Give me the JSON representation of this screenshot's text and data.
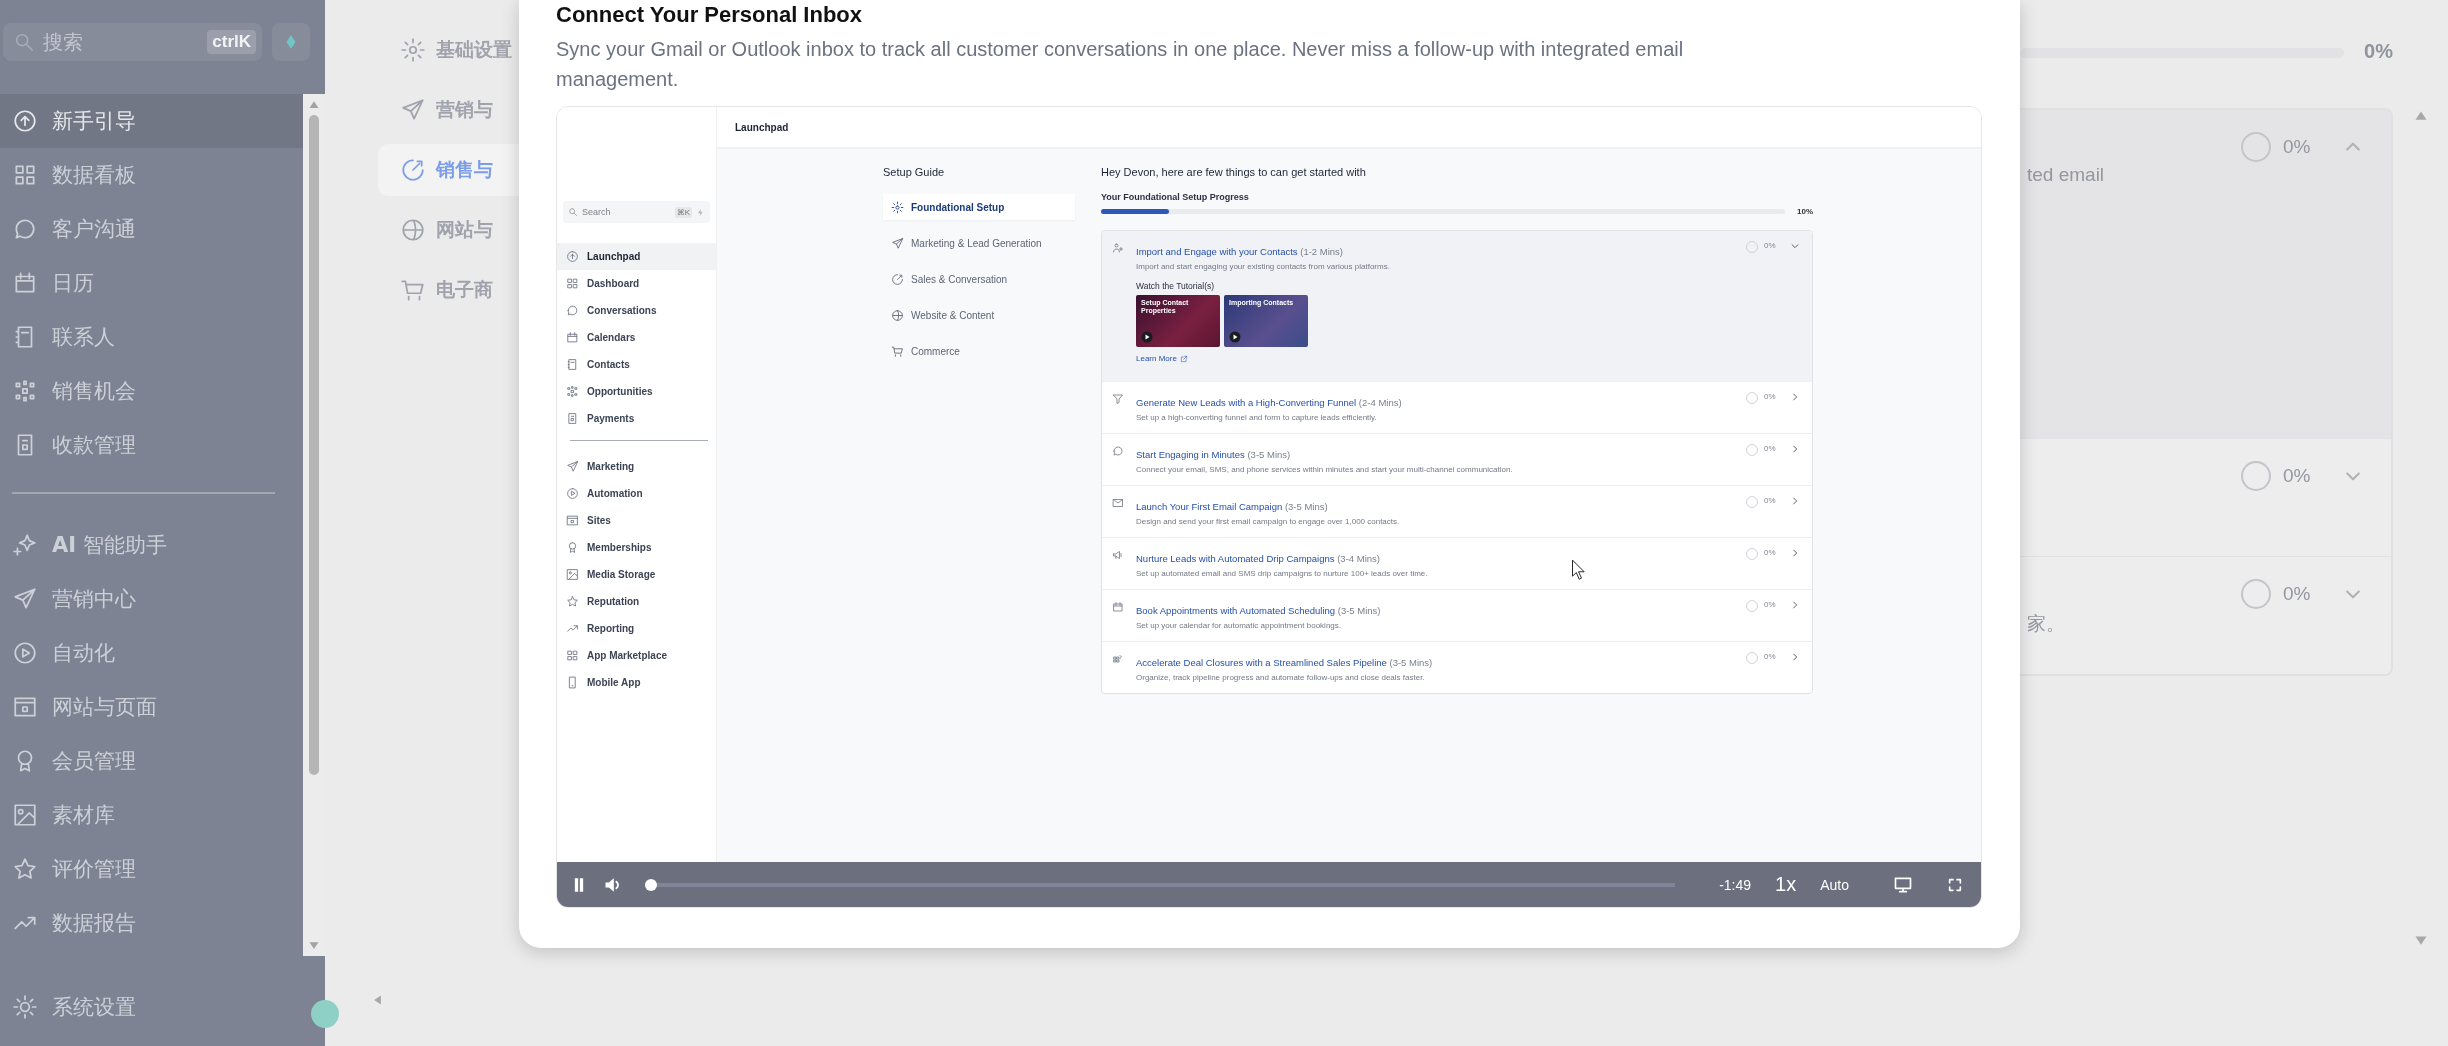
{
  "sidebar": {
    "search": {
      "placeholder": "搜索",
      "shortcut": "ctrlK"
    },
    "sections": [
      [
        {
          "label": "新手引导",
          "selected": true
        },
        {
          "label": "数据看板",
          "selected": false
        },
        {
          "label": "客户沟通",
          "selected": false
        },
        {
          "label": "日历",
          "selected": false
        },
        {
          "label": "联系人",
          "selected": false
        },
        {
          "label": "销售机会",
          "selected": false
        },
        {
          "label": "收款管理",
          "selected": false
        }
      ],
      [
        {
          "label": "**AI** 智能助手",
          "selected": false
        },
        {
          "label": "营销中心",
          "selected": false
        },
        {
          "label": "自动化",
          "selected": false
        },
        {
          "label": "网站与页面",
          "selected": false
        },
        {
          "label": "会员管理",
          "selected": false
        },
        {
          "label": "素材库",
          "selected": false
        },
        {
          "label": "评价管理",
          "selected": false
        },
        {
          "label": "数据报告",
          "selected": false
        }
      ]
    ],
    "footer": {
      "label": "系统设置"
    }
  },
  "background": {
    "nav": [
      {
        "label": "基础设置",
        "selected": false
      },
      {
        "label": "营销与",
        "selected": false
      },
      {
        "label": "销售与",
        "selected": true
      },
      {
        "label": "网站与",
        "selected": false
      },
      {
        "label": "电子商",
        "selected": false
      }
    ],
    "progress": {
      "reading": "0%"
    },
    "tasks": [
      {
        "fragment": "ted email",
        "reading": "0%",
        "expanded": true
      },
      {
        "reading": "0%",
        "expanded": false
      },
      {
        "fragment": "家。",
        "reading": "0%",
        "expanded": false
      }
    ]
  },
  "modal": {
    "title": "Connect Your Personal Inbox",
    "description": "Sync your Gmail or Outlook inbox to track all customer conversations in one place. Never miss a follow-up with integrated email management.",
    "video": {
      "app": {
        "header": "Launchpad",
        "sidebar": {
          "search": {
            "placeholder": "Search",
            "shortcut": "⌘K"
          },
          "sections": [
            [
              {
                "label": "Launchpad",
                "selected": true
              },
              {
                "label": "Dashboard",
                "selected": false
              },
              {
                "label": "Conversations",
                "selected": false
              },
              {
                "label": "Calendars",
                "selected": false
              },
              {
                "label": "Contacts",
                "selected": false
              },
              {
                "label": "Opportunities",
                "selected": false
              },
              {
                "label": "Payments",
                "selected": false
              }
            ],
            [
              {
                "label": "Marketing",
                "selected": false
              },
              {
                "label": "Automation",
                "selected": false
              },
              {
                "label": "Sites",
                "selected": false
              },
              {
                "label": "Memberships",
                "selected": false
              },
              {
                "label": "Media Storage",
                "selected": false
              },
              {
                "label": "Reputation",
                "selected": false
              },
              {
                "label": "Reporting",
                "selected": false
              },
              {
                "label": "App Marketplace",
                "selected": false
              },
              {
                "label": "Mobile App",
                "selected": false
              }
            ]
          ]
        },
        "guide": {
          "title": "Setup Guide",
          "items": [
            {
              "label": "Foundational Setup",
              "selected": true
            },
            {
              "label": "Marketing & Lead Generation",
              "selected": false
            },
            {
              "label": "Sales & Conversation",
              "selected": false
            },
            {
              "label": "Website & Content",
              "selected": false
            },
            {
              "label": "Commerce",
              "selected": false
            }
          ]
        },
        "greeting": "Hey Devon, here are few things to can get started with",
        "progress": {
          "label": "Your Foundational Setup Progress",
          "level": 0.1,
          "reading": "10%"
        },
        "tasks": [
          {
            "title": "Import and Engage with your Contacts",
            "duration": "(1-2 Mins)",
            "description": "Import and start engaging your existing contacts from various platforms.",
            "reading": "0%",
            "expanded": true,
            "tutorials": {
              "heading": "Watch the Tutorial(s)",
              "items": [
                {
                  "title": "Setup Contact Properties"
                },
                {
                  "title": "Importing Contacts"
                }
              ],
              "link": "Learn More"
            }
          },
          {
            "title": "Generate New Leads with a High-Converting Funnel",
            "duration": "(2-4 Mins)",
            "description": "Set up a high-converting funnel and form to capture leads efficiently.",
            "reading": "0%",
            "expanded": false
          },
          {
            "title": "Start Engaging in Minutes",
            "duration": "(3-5 Mins)",
            "description": "Connect your email, SMS, and phone services within minutes and start your multi-channel communication.",
            "reading": "0%",
            "expanded": false
          },
          {
            "title": "Launch Your First Email Campaign",
            "duration": "(3-5 Mins)",
            "description": "Design and send your first email campaign to engage over 1,000 contacts.",
            "reading": "0%",
            "expanded": false
          },
          {
            "title": "Nurture Leads with Automated Drip Campaigns",
            "duration": "(3-4 Mins)",
            "description": "Set up automated email and SMS drip campaigns to nurture 100+ leads over time.",
            "reading": "0%",
            "expanded": false
          },
          {
            "title": "Book Appointments with Automated Scheduling",
            "duration": "(3-5 Mins)",
            "description": "Set up your calendar for automatic appointment bookings.",
            "reading": "0%",
            "expanded": false
          },
          {
            "title": "Accelerate Deal Closures with a Streamlined Sales Pipeline",
            "duration": "(3-5 Mins)",
            "description": "Organize, track pipeline progress and automate follow-ups and close deals faster.",
            "reading": "0%",
            "expanded": false
          }
        ]
      },
      "controls": {
        "playing": true,
        "level": 0,
        "time": "-1:49",
        "speed": "1x",
        "quality": "Auto"
      }
    }
  }
}
